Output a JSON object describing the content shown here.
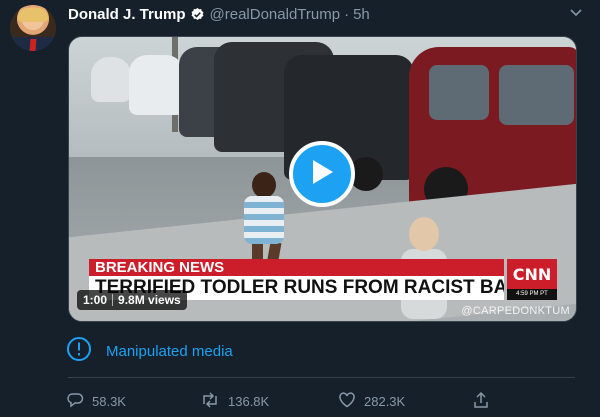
{
  "author": {
    "name": "Donald J. Trump",
    "handle": "@realDonaldTrump",
    "separator": "·",
    "time": "5h"
  },
  "media": {
    "breaking_label": "BREAKING NEWS",
    "headline": "TERRIFIED TODLER RUNS FROM RACIST BABY",
    "network_logo": "CNN",
    "network_time": "4:59 PM PT",
    "watermark": "@CARPEDONKTUM",
    "duration": "1:00",
    "views": "9.8M views",
    "play_icon": "play-icon"
  },
  "notice": {
    "label": "Manipulated media",
    "icon": "info-circle-icon"
  },
  "actions": {
    "reply_count": "58.3K",
    "retweet_count": "136.8K",
    "like_count": "282.3K"
  },
  "colors": {
    "background": "#15202b",
    "accent": "#1da1f2",
    "muted": "#8899a6",
    "border": "#38444d",
    "cnn_red": "#cc1d2a"
  }
}
